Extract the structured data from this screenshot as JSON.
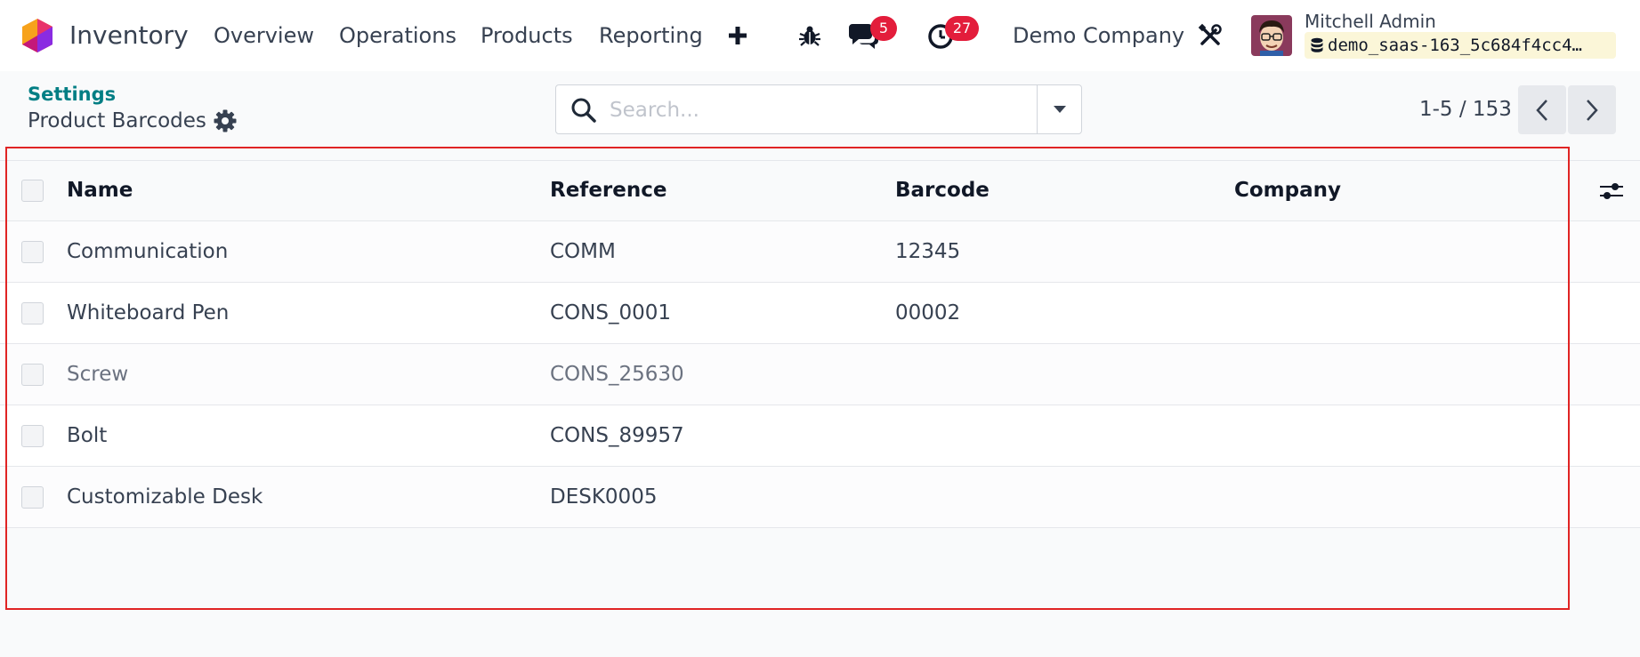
{
  "app": {
    "name": "Inventory"
  },
  "navbar": {
    "menu": [
      {
        "label": "Overview"
      },
      {
        "label": "Operations"
      },
      {
        "label": "Products"
      },
      {
        "label": "Reporting"
      }
    ],
    "messages_count": "5",
    "activities_count": "27",
    "company": "Demo Company",
    "user": {
      "name": "Mitchell Admin",
      "database": "demo_saas-163_5c684f4cc4…"
    }
  },
  "control_panel": {
    "breadcrumb": "Settings",
    "title": "Product Barcodes",
    "search": {
      "placeholder": "Search...",
      "value": ""
    },
    "pager": "1-5 / 153"
  },
  "table": {
    "columns": [
      "Name",
      "Reference",
      "Barcode",
      "Company"
    ],
    "rows": [
      {
        "name": "Communication",
        "reference": "COMM",
        "barcode": "12345",
        "company": ""
      },
      {
        "name": "Whiteboard Pen",
        "reference": "CONS_0001",
        "barcode": "00002",
        "company": ""
      },
      {
        "name": "Screw",
        "reference": "CONS_25630",
        "barcode": "",
        "company": ""
      },
      {
        "name": "Bolt",
        "reference": "CONS_89957",
        "barcode": "",
        "company": ""
      },
      {
        "name": "Customizable Desk",
        "reference": "DESK0005",
        "barcode": "",
        "company": ""
      }
    ]
  },
  "colors": {
    "accent": "#017e84",
    "badge": "#e31d3b",
    "highlight": "#e02424"
  }
}
